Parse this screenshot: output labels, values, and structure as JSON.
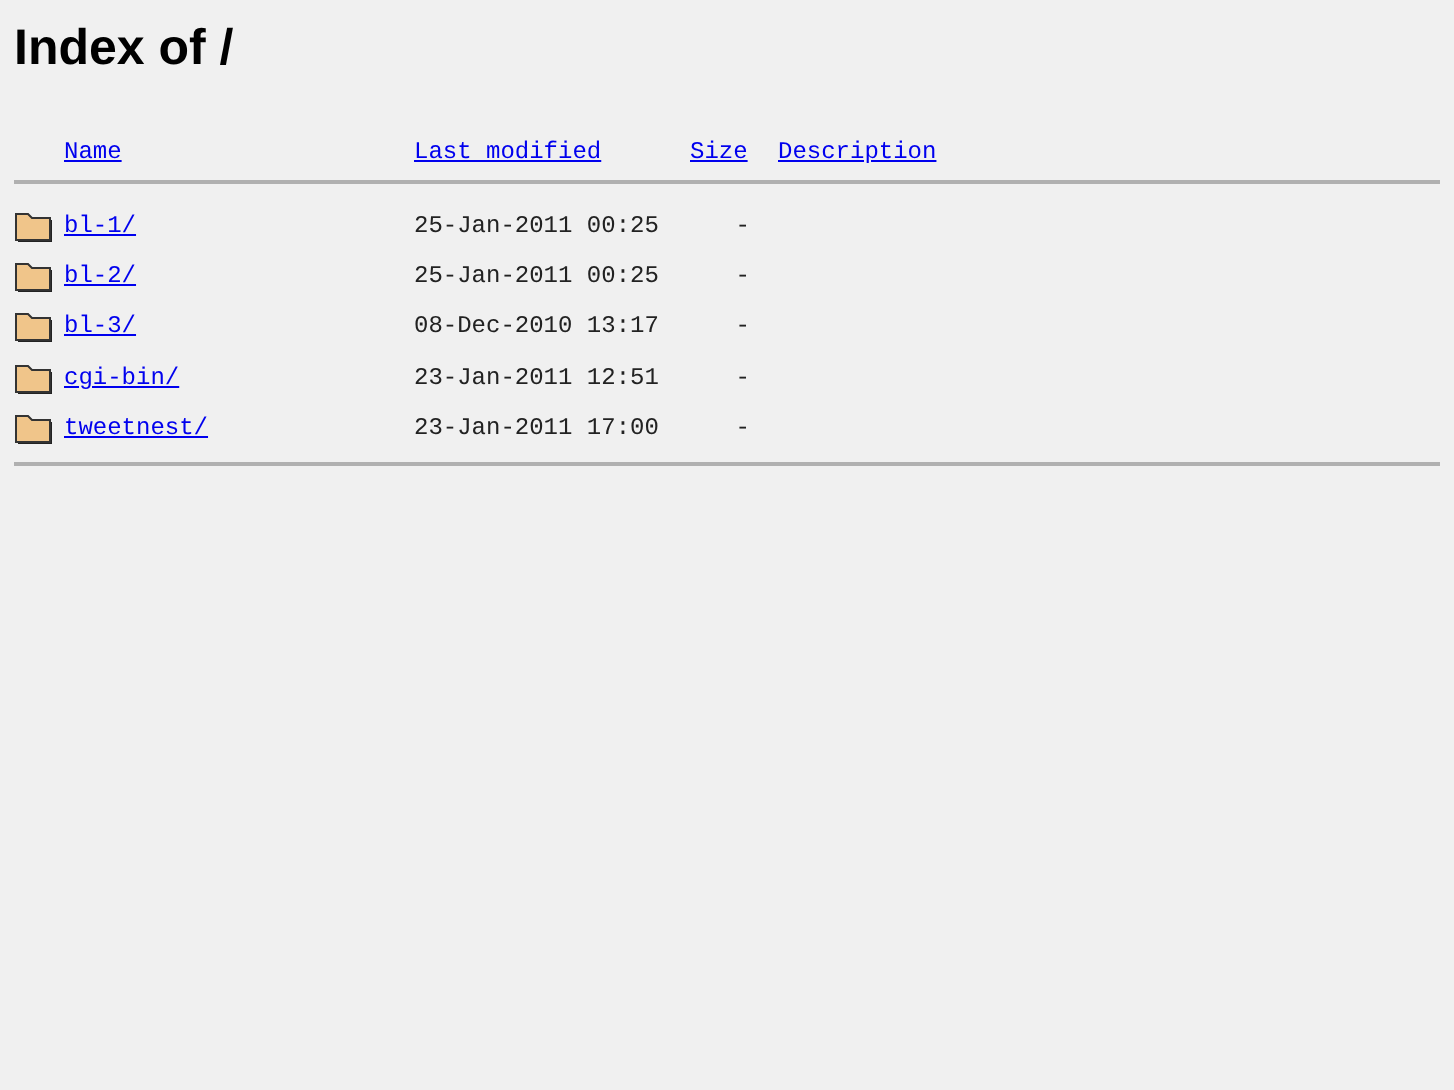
{
  "title": "Index of /",
  "columns": [
    "Name",
    "Last modified",
    "Size",
    "Description"
  ],
  "rows": [
    {
      "name": "bl-1/",
      "modified": "25-Jan-2011 00:25",
      "size": "-"
    },
    {
      "name": "bl-2/",
      "modified": "25-Jan-2011 00:25",
      "size": "-"
    },
    {
      "name": "bl-3/",
      "modified": "08-Dec-2010 13:17",
      "size": "-"
    },
    {
      "name": "cgi-bin/",
      "modified": "23-Jan-2011 12:51",
      "size": "-"
    },
    {
      "name": "tweetnest/",
      "modified": "23-Jan-2011 17:00",
      "size": "-"
    }
  ]
}
